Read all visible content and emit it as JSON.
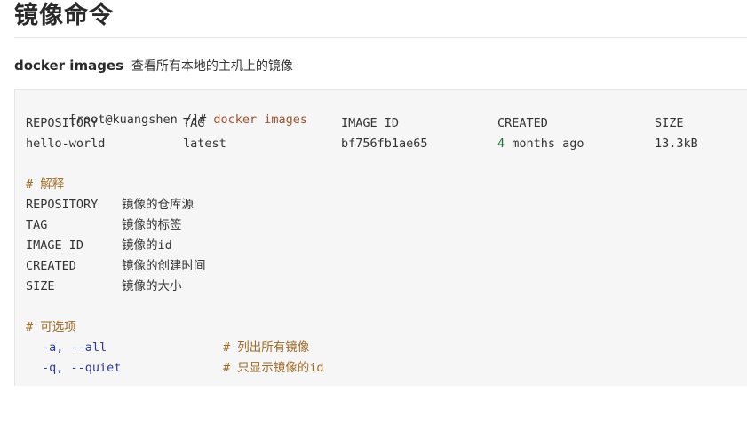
{
  "title": "镜像命令",
  "intro": {
    "command": "docker images",
    "description": "查看所有本地的主机上的镜像"
  },
  "code": {
    "prompt": "[root@kuangshen /]#",
    "command": "docker images",
    "table_headers": [
      "REPOSITORY",
      "TAG",
      "IMAGE ID",
      "CREATED",
      "SIZE"
    ],
    "table_row": {
      "repository": "hello-world",
      "tag": "latest",
      "image_id": "bf756fb1ae65",
      "created_num": "4",
      "created_rest": "months ago",
      "size": "13.3kB"
    },
    "explain_comment": "# 解释",
    "explanations": [
      {
        "term": "REPOSITORY",
        "meaning": "镜像的仓库源"
      },
      {
        "term": "TAG",
        "meaning": "镜像的标签"
      },
      {
        "term": "IMAGE ID",
        "meaning": "镜像的id"
      },
      {
        "term": "CREATED",
        "meaning": "镜像的创建时间"
      },
      {
        "term": "SIZE",
        "meaning": "镜像的大小"
      }
    ],
    "options_comment": "# 可选项",
    "options": [
      {
        "flag": "-a, --all",
        "comment": "# 列出所有镜像"
      },
      {
        "flag": "-q, --quiet",
        "comment": "# 只显示镜像的id"
      }
    ]
  }
}
